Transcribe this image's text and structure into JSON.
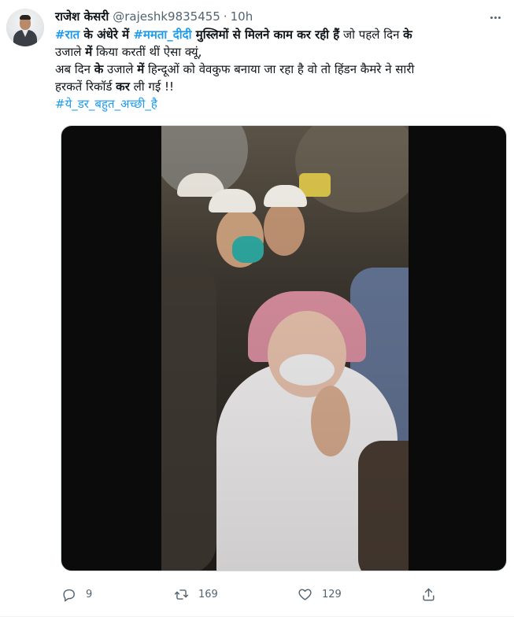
{
  "tweet": {
    "author": {
      "name": "राजेश केसरी",
      "handle": "@rajeshk9835455",
      "separator": "·",
      "time": "10h"
    },
    "body": {
      "line1": {
        "tag1": "#रात",
        "t1": " के अंधेरे में ",
        "tag2": "#ममता_दीदी",
        "t2": " मुस्लिमों से मिलने काम कर रही हैं",
        "t3": " जो पहले दिन ",
        "t4": "के"
      },
      "line2": {
        "t1": "उजाले ",
        "t2": "में",
        "t3": " किया करतीं थीं ऐसा क्यूं,"
      },
      "line3": {
        "t1": "अब दिन ",
        "t2": "के",
        "t3": " उजाले ",
        "t4": "में",
        "t5": " हिन्दूओं को वेवकुफ बनाया जा रहा है वो तो हिंडन कैमरे ने सारी"
      },
      "line4": {
        "t1": "हरकतें रिकॉर्ड ",
        "t2": "कर",
        "t3": " ली गई !!"
      },
      "line5": {
        "tag": "#ये_डर_बहुत_अच्छी_है"
      }
    },
    "media": {
      "type": "video"
    },
    "actions": {
      "reply_count": "9",
      "retweet_count": "169",
      "like_count": "129"
    },
    "icons": {
      "more": "more-icon",
      "reply": "reply-icon",
      "retweet": "retweet-icon",
      "like": "heart-icon",
      "share": "share-icon"
    },
    "colors": {
      "accent": "#1d9bf0",
      "text": "#0f1419",
      "muted": "#536471"
    }
  }
}
